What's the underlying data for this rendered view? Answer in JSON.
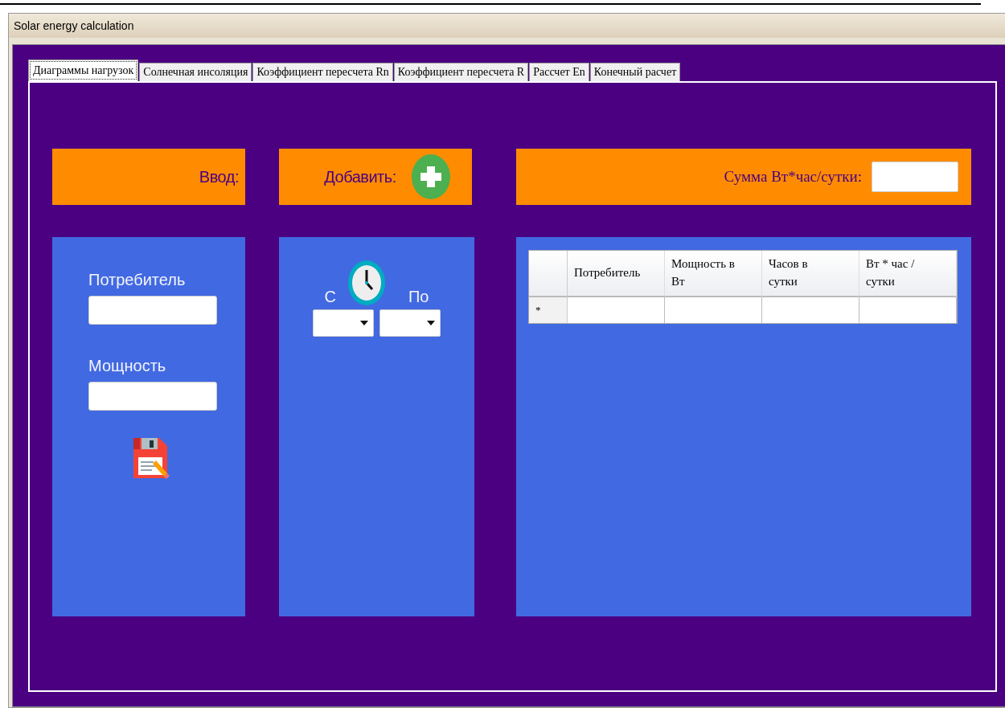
{
  "window": {
    "title": "Solar energy calculation"
  },
  "tabs": [
    {
      "label": "Диаграммы нагрузок",
      "selected": true
    },
    {
      "label": "Солнечная инсоляция",
      "selected": false
    },
    {
      "label": "Коэффициент пересчета Rn",
      "selected": false
    },
    {
      "label": "Коэффициент пересчета R",
      "selected": false
    },
    {
      "label": "Рассчет En",
      "selected": false
    },
    {
      "label": "Конечный расчет",
      "selected": false
    }
  ],
  "input_panel": {
    "header": "Ввод:",
    "fields": [
      {
        "label": "Потребитель"
      },
      {
        "label": "Мощность"
      }
    ]
  },
  "add_panel": {
    "header": "Добавить:",
    "from_label": "С",
    "to_label": "По"
  },
  "sum_panel": {
    "label": "Сумма Вт*час/сутки:"
  },
  "table": {
    "columns": [
      "Потребитель",
      "Мощность в Вт",
      "Часов в сутки",
      "Вт * час / сутки"
    ],
    "new_row_marker": "*"
  }
}
